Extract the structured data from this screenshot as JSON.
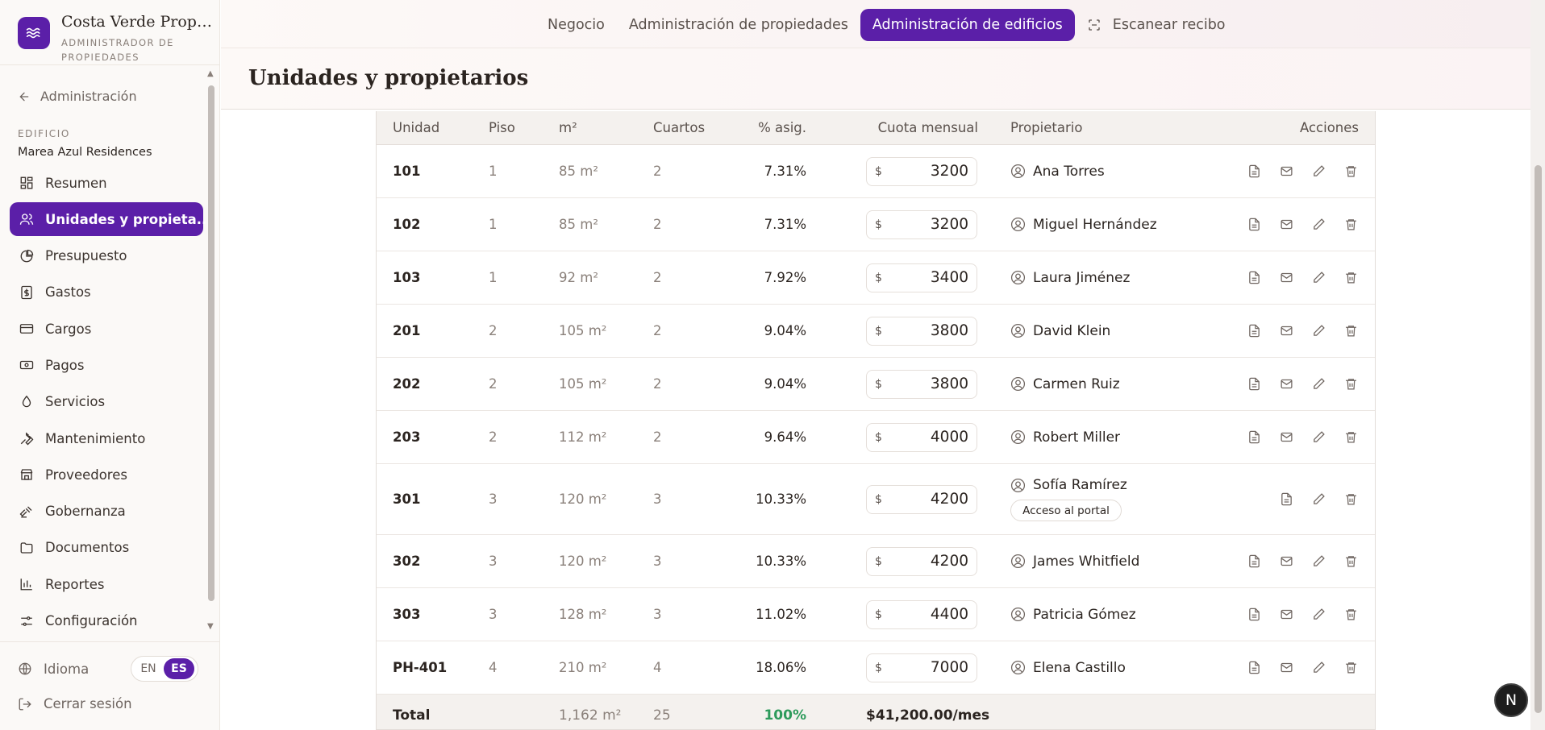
{
  "brand": {
    "name": "Costa Verde Proper...",
    "subtitle": "ADMINISTRADOR DE PROPIEDADES"
  },
  "sidebar": {
    "back_label": "Administración",
    "edificio_label": "EDIFICIO",
    "edificio_name": "Marea Azul Residences",
    "items": [
      {
        "label": "Resumen",
        "icon": "grid-icon"
      },
      {
        "label": "Unidades y propieta...",
        "icon": "users-icon",
        "active": true
      },
      {
        "label": "Presupuesto",
        "icon": "pie-chart-icon"
      },
      {
        "label": "Gastos",
        "icon": "receipt-icon"
      },
      {
        "label": "Cargos",
        "icon": "credit-card-icon"
      },
      {
        "label": "Pagos",
        "icon": "banknote-icon"
      },
      {
        "label": "Servicios",
        "icon": "droplet-icon"
      },
      {
        "label": "Mantenimiento",
        "icon": "wrench-icon"
      },
      {
        "label": "Proveedores",
        "icon": "store-icon"
      },
      {
        "label": "Gobernanza",
        "icon": "gavel-icon"
      },
      {
        "label": "Documentos",
        "icon": "folder-icon"
      },
      {
        "label": "Reportes",
        "icon": "bar-chart-icon"
      },
      {
        "label": "Configuración",
        "icon": "sliders-icon"
      }
    ],
    "language_label": "Idioma",
    "lang_en": "EN",
    "lang_es": "ES",
    "logout_label": "Cerrar sesión"
  },
  "topnav": {
    "tabs": [
      "Negocio",
      "Administración de propiedades",
      "Administración de edificios",
      "Escanear recibo"
    ]
  },
  "header": {
    "title": "Unidades y propietarios"
  },
  "table": {
    "columns": [
      "Unidad",
      "Piso",
      "m²",
      "Cuartos",
      "% asig.",
      "Cuota mensual",
      "Propietario",
      "Acciones"
    ],
    "currency": "$",
    "rows": [
      {
        "unit": "101",
        "piso": "1",
        "m2": "85 m²",
        "cuartos": "2",
        "pct": "7.31%",
        "cuota": "3200",
        "owner": "Ana Torres"
      },
      {
        "unit": "102",
        "piso": "1",
        "m2": "85 m²",
        "cuartos": "2",
        "pct": "7.31%",
        "cuota": "3200",
        "owner": "Miguel Hernández"
      },
      {
        "unit": "103",
        "piso": "1",
        "m2": "92 m²",
        "cuartos": "2",
        "pct": "7.92%",
        "cuota": "3400",
        "owner": "Laura Jiménez"
      },
      {
        "unit": "201",
        "piso": "2",
        "m2": "105 m²",
        "cuartos": "2",
        "pct": "9.04%",
        "cuota": "3800",
        "owner": "David Klein"
      },
      {
        "unit": "202",
        "piso": "2",
        "m2": "105 m²",
        "cuartos": "2",
        "pct": "9.04%",
        "cuota": "3800",
        "owner": "Carmen Ruiz"
      },
      {
        "unit": "203",
        "piso": "2",
        "m2": "112 m²",
        "cuartos": "2",
        "pct": "9.64%",
        "cuota": "4000",
        "owner": "Robert Miller"
      },
      {
        "unit": "301",
        "piso": "3",
        "m2": "120 m²",
        "cuartos": "3",
        "pct": "10.33%",
        "cuota": "4200",
        "owner": "Sofía Ramírez",
        "portal": "Acceso al portal"
      },
      {
        "unit": "302",
        "piso": "3",
        "m2": "120 m²",
        "cuartos": "3",
        "pct": "10.33%",
        "cuota": "4200",
        "owner": "James Whitfield"
      },
      {
        "unit": "303",
        "piso": "3",
        "m2": "128 m²",
        "cuartos": "3",
        "pct": "11.02%",
        "cuota": "4400",
        "owner": "Patricia Gómez"
      },
      {
        "unit": "PH-401",
        "piso": "4",
        "m2": "210 m²",
        "cuartos": "4",
        "pct": "18.06%",
        "cuota": "7000",
        "owner": "Elena Castillo"
      }
    ],
    "total": {
      "label": "Total",
      "m2": "1,162 m²",
      "cuartos": "25",
      "pct": "100%",
      "cuota": "$41,200.00/mes"
    }
  },
  "fab_label": "N",
  "colors": {
    "accent": "#5b1fa8",
    "positive": "#2e9b5c"
  }
}
